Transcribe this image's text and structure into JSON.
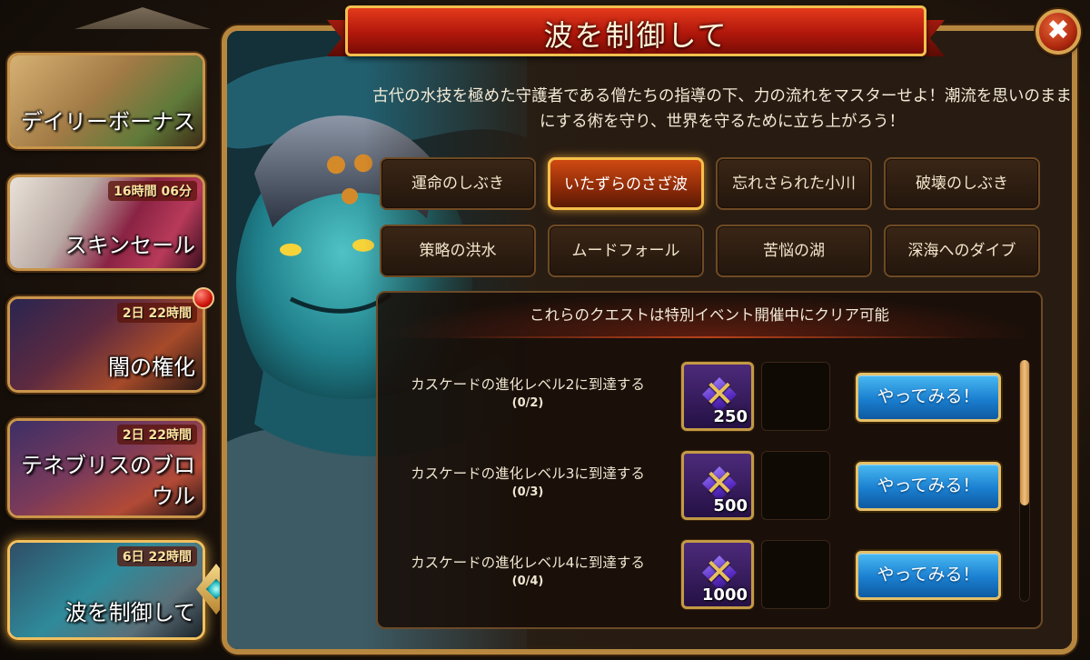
{
  "sidebar": {
    "items": [
      {
        "label": "デイリーボーナス",
        "timer": ""
      },
      {
        "label": "スキンセール",
        "timer": "16時間 06分"
      },
      {
        "label": "闇の権化",
        "timer": "2日 22時間"
      },
      {
        "label": "テネブリスのブロ\nウル",
        "timer": "2日 22時間"
      },
      {
        "label": "波を制御して",
        "timer": "6日 22時間"
      }
    ]
  },
  "panel": {
    "title": "波を制御して",
    "close_icon": "close-icon",
    "description": "古代の水技を極めた守護者である僧たちの指導の下、力の流れをマスターせよ！潮流を思いのままにする術を守り、世界を守るために立ち上がろう！",
    "tabs": [
      {
        "label": "運命のしぶき",
        "active": false
      },
      {
        "label": "いたずらのさざ波",
        "active": true
      },
      {
        "label": "忘れさられた小川",
        "active": false
      },
      {
        "label": "破壊のしぶき",
        "active": false
      },
      {
        "label": "策略の洪水",
        "active": false
      },
      {
        "label": "ムードフォール",
        "active": false
      },
      {
        "label": "苦悩の湖",
        "active": false
      },
      {
        "label": "深海へのダイブ",
        "active": false
      }
    ],
    "quests": {
      "header": "これらのクエストは特別イベント開催中にクリア可能",
      "rows": [
        {
          "name": "カスケードの進化レベル2に到達する",
          "progress": "(0/2)",
          "reward_amount": "250",
          "button": "やってみる！"
        },
        {
          "name": "カスケードの進化レベル3に到達する",
          "progress": "(0/3)",
          "reward_amount": "500",
          "button": "やってみる！"
        },
        {
          "name": "カスケードの進化レベル4に到達する",
          "progress": "(0/4)",
          "reward_amount": "1000",
          "button": "やってみる！"
        }
      ]
    }
  },
  "colors": {
    "frame_gold": "#b7873f",
    "banner_red": "#b1170b",
    "active_tab": "#cf4a12",
    "button_blue": "#1a7fd0"
  }
}
